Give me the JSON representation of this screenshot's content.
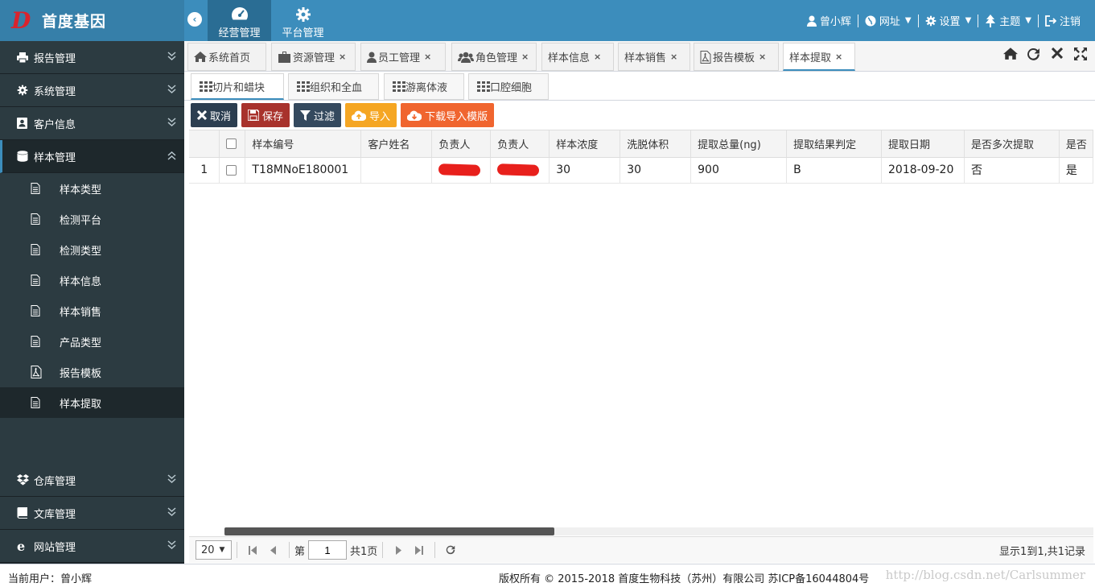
{
  "brand": {
    "logo_letter": "D",
    "name": "首度基因"
  },
  "header": {
    "toggle": "‹",
    "modules": [
      {
        "label": "经营管理",
        "icon": "dashboard-icon"
      },
      {
        "label": "平台管理",
        "icon": "gear-icon"
      }
    ],
    "user": "曾小辉",
    "website": "网址",
    "settings": "设置",
    "theme": "主题",
    "logout": "注销"
  },
  "sidebar": {
    "groups_top": [
      {
        "label": "报告管理",
        "icon": "print-icon"
      },
      {
        "label": "系统管理",
        "icon": "gear-icon"
      },
      {
        "label": "客户信息",
        "icon": "contact-card-icon"
      }
    ],
    "open_group": {
      "label": "样本管理",
      "icon": "database-icon"
    },
    "sub_items": [
      {
        "label": "样本类型",
        "icon": "document-icon"
      },
      {
        "label": "检测平台",
        "icon": "document-icon"
      },
      {
        "label": "检测类型",
        "icon": "document-icon"
      },
      {
        "label": "样本信息",
        "icon": "document-icon"
      },
      {
        "label": "样本销售",
        "icon": "document-icon"
      },
      {
        "label": "产品类型",
        "icon": "document-icon"
      },
      {
        "label": "报告模板",
        "icon": "pdf-icon"
      },
      {
        "label": "样本提取",
        "icon": "document-icon"
      }
    ],
    "groups_bottom": [
      {
        "label": "仓库管理",
        "icon": "dropbox-icon"
      },
      {
        "label": "文库管理",
        "icon": "book-icon"
      },
      {
        "label": "网站管理",
        "icon": "ie-icon"
      }
    ]
  },
  "tabs": [
    {
      "label": "系统首页",
      "icon": "home-icon"
    },
    {
      "label": "资源管理",
      "icon": "briefcase-icon"
    },
    {
      "label": "员工管理",
      "icon": "user-icon"
    },
    {
      "label": "角色管理",
      "icon": "users-icon"
    },
    {
      "label": "样本信息"
    },
    {
      "label": "样本销售"
    },
    {
      "label": "报告模板",
      "icon": "pdf-icon"
    },
    {
      "label": "样本提取"
    }
  ],
  "tab_close": "×",
  "subtabs": [
    "切片和蜡块",
    "组织和全血",
    "游离体液",
    "口腔细胞"
  ],
  "toolbar": {
    "cancel": "取消",
    "save": "保存",
    "filter": "过滤",
    "import": "导入",
    "download_template": "下载导入模版"
  },
  "table": {
    "columns": [
      "样本编号",
      "客户姓名",
      "负责人",
      "负责人",
      "样本浓度",
      "洗脱体积",
      "提取总量(ng)",
      "提取结果判定",
      "提取日期",
      "是否多次提取",
      "是否"
    ],
    "rows": [
      {
        "num": "1",
        "cells": [
          "T18MNoE180001",
          "",
          "",
          "",
          "30",
          "30",
          "900",
          "B",
          "2018-09-20",
          "否",
          "是"
        ]
      }
    ]
  },
  "pager": {
    "page_size": "20",
    "page_prefix": "第",
    "page": "1",
    "page_suffix": "共1页",
    "info": "显示1到1,共1记录",
    "scroll_fraction": 0.38
  },
  "footer": {
    "current_user": "当前用户：曾小辉",
    "copyright": "版权所有 © 2015-2018 首度生物科技（苏州）有限公司 苏ICP备16044804号",
    "watermark": "http://blog.csdn.net/Carlsummer"
  }
}
